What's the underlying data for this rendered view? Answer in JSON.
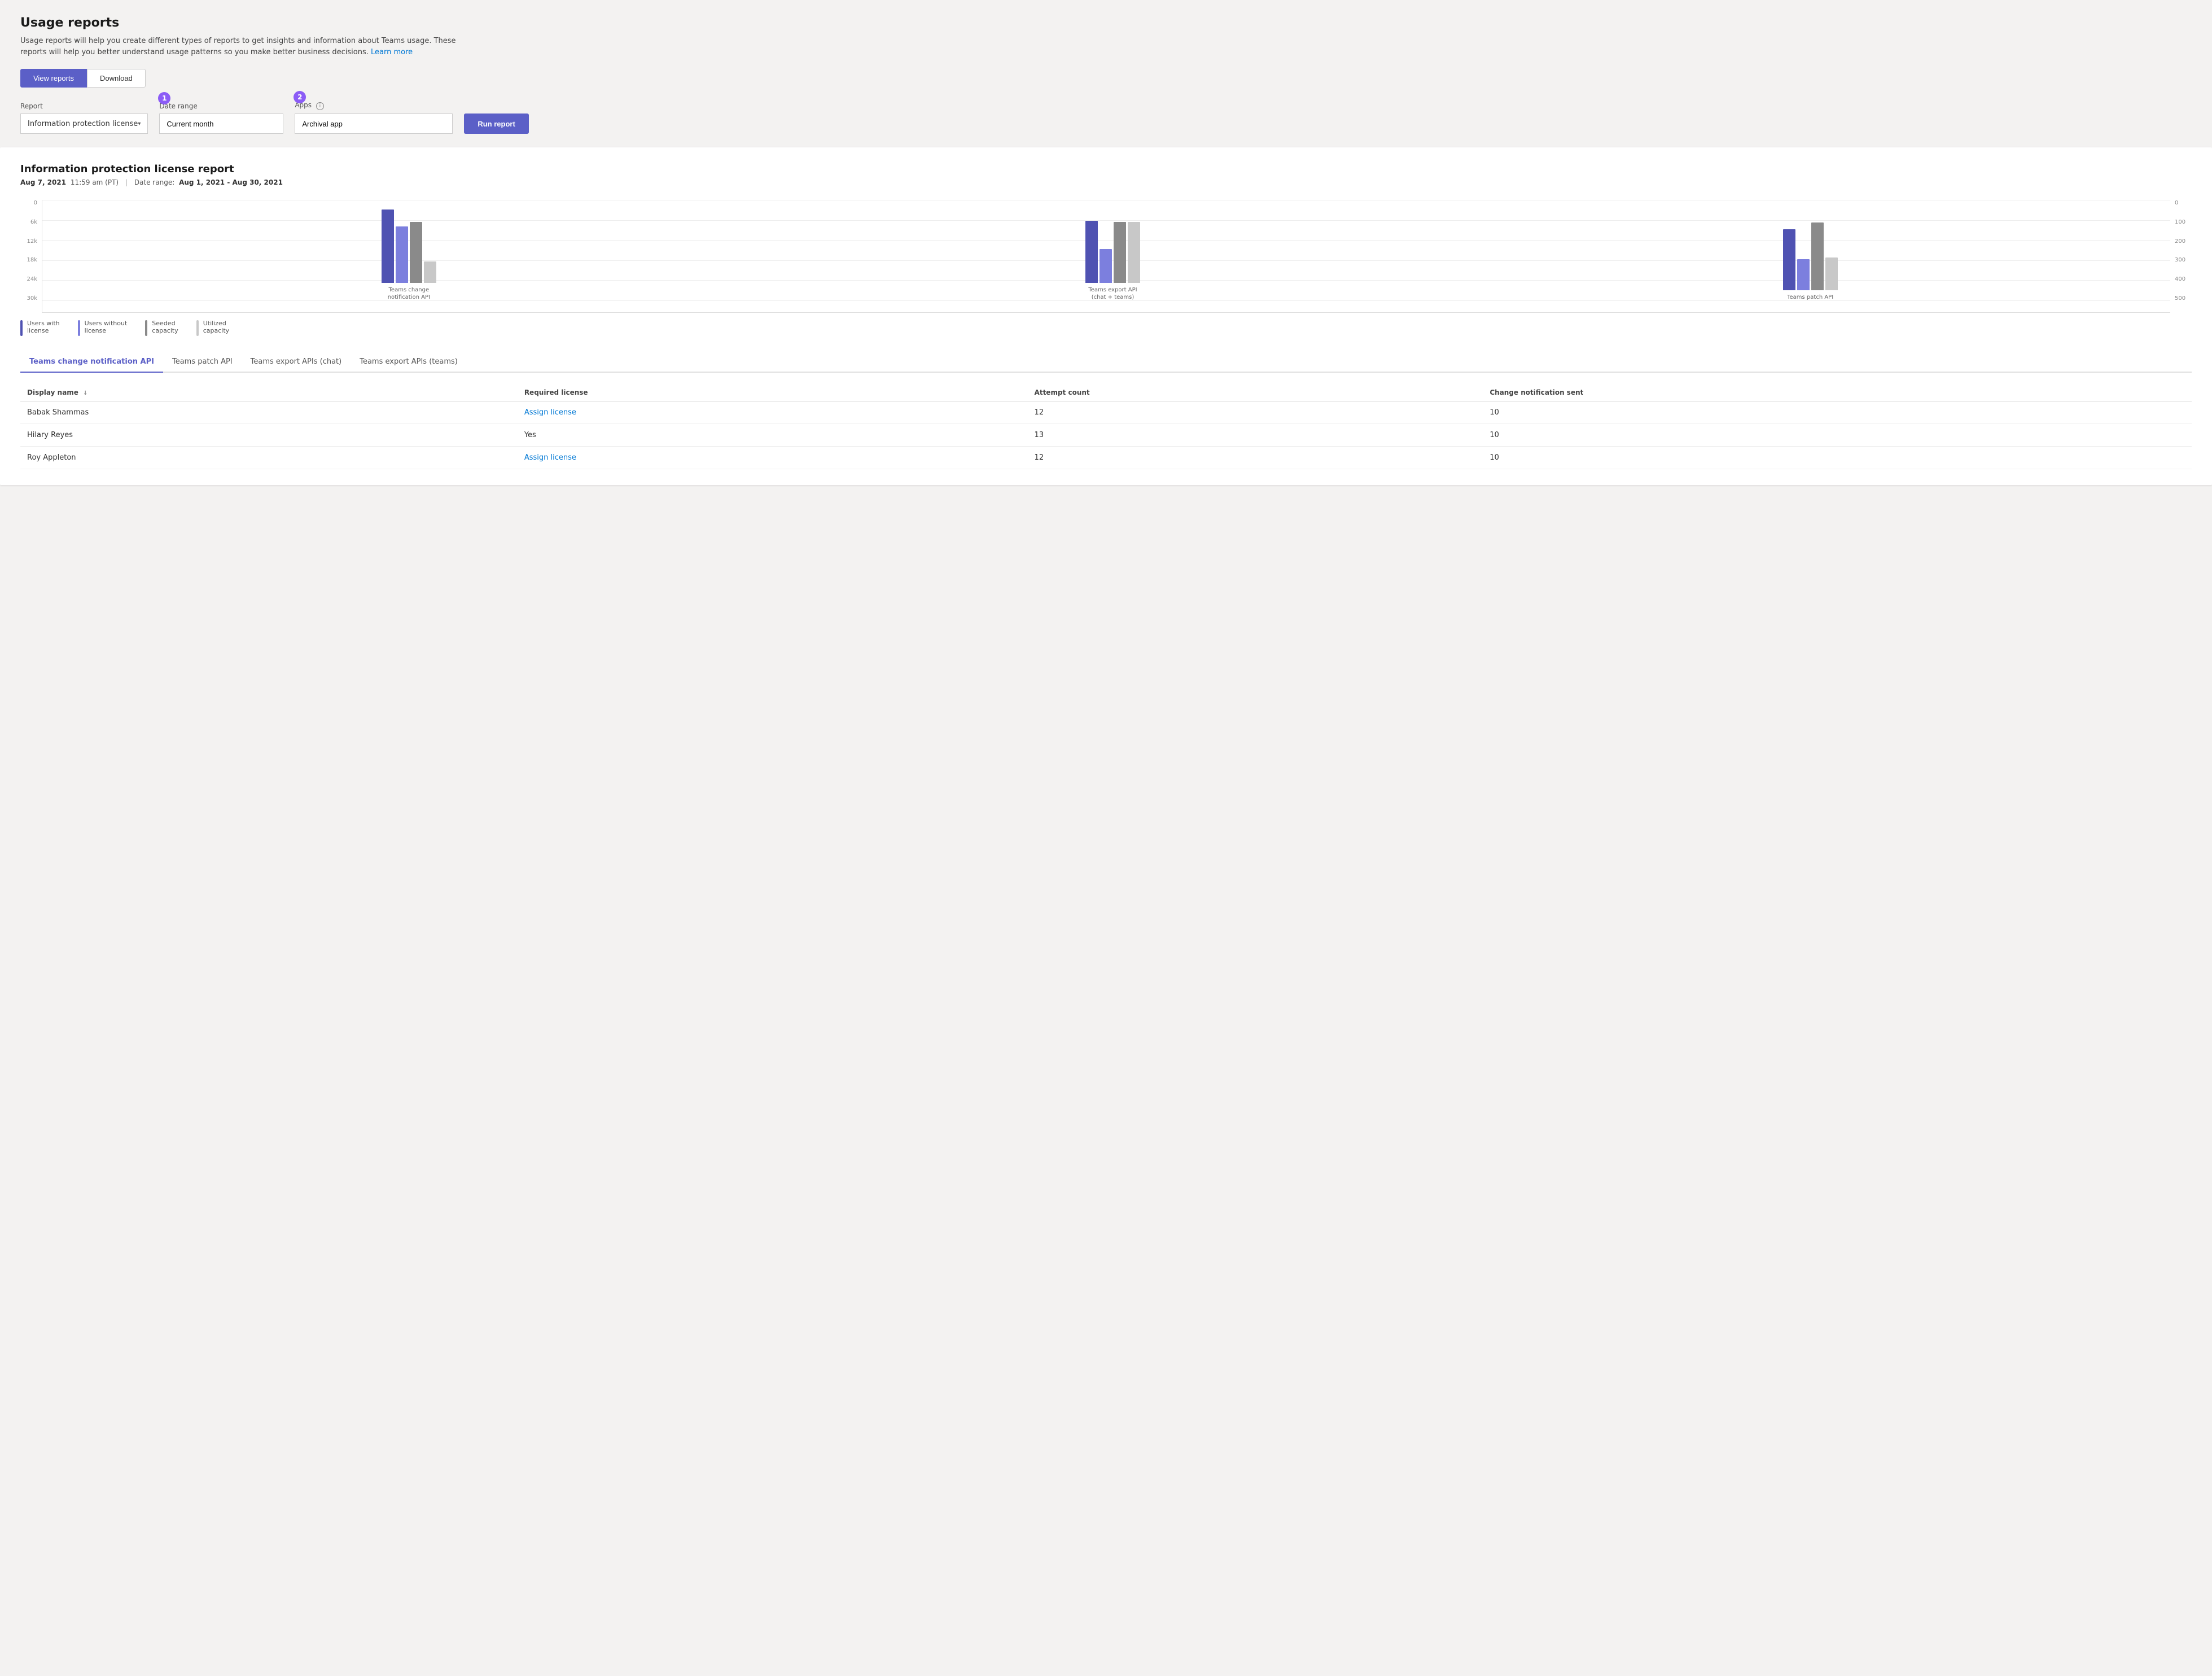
{
  "page": {
    "title": "Usage reports",
    "description": "Usage reports will help you create different types of reports to get insights and information about Teams usage. These reports will help you better understand usage patterns so you make better business decisions.",
    "learn_more_text": "Learn more",
    "tabs": [
      {
        "id": "view-reports",
        "label": "View reports",
        "active": true
      },
      {
        "id": "download",
        "label": "Download",
        "active": false
      }
    ]
  },
  "filters": {
    "report_label": "Report",
    "report_value": "Information protection license",
    "date_range_label": "Date range",
    "date_range_value": "Current month",
    "date_range_step": "1",
    "apps_label": "Apps",
    "apps_step": "2",
    "apps_value": "Archival app",
    "run_button_label": "Run report"
  },
  "report": {
    "title": "Information protection license report",
    "timestamp": "Aug 7, 2021",
    "time": "11:59 am (PT)",
    "date_range_label": "Date range:",
    "date_range_value": "Aug 1, 2021 - Aug 30, 2021",
    "y_axis_left": [
      "0",
      "6k",
      "12k",
      "18k",
      "24k",
      "30k"
    ],
    "y_axis_right": [
      "0",
      "100",
      "200",
      "300",
      "400",
      "500"
    ],
    "chart_groups": [
      {
        "label": "Teams change notification API",
        "bars": [
          {
            "type": "blue",
            "height": 130
          },
          {
            "type": "purple",
            "height": 100
          },
          {
            "type": "gray",
            "height": 108
          },
          {
            "type": "lightgray",
            "height": 38
          }
        ]
      },
      {
        "label": "Teams export API\n(chat + teams)",
        "bars": [
          {
            "type": "blue",
            "height": 110
          },
          {
            "type": "purple",
            "height": 60
          },
          {
            "type": "gray",
            "height": 108
          },
          {
            "type": "lightgray",
            "height": 108
          }
        ]
      },
      {
        "label": "Teams patch API",
        "bars": [
          {
            "type": "blue",
            "height": 108
          },
          {
            "type": "purple",
            "height": 55
          },
          {
            "type": "gray",
            "height": 120
          },
          {
            "type": "lightgray",
            "height": 58
          }
        ]
      }
    ],
    "legend": [
      {
        "color": "#4f52b2",
        "label": "Users with\nlicense"
      },
      {
        "color": "#7c7fde",
        "label": "Users without\nlicense"
      },
      {
        "color": "#8a8a8a",
        "label": "Seeded\ncapacity"
      },
      {
        "color": "#c8c8c8",
        "label": "Utilized\ncapacity"
      }
    ],
    "data_tabs": [
      {
        "id": "change-notification",
        "label": "Teams change notification API",
        "active": true
      },
      {
        "id": "patch-api",
        "label": "Teams patch API",
        "active": false
      },
      {
        "id": "export-chat",
        "label": "Teams export APIs (chat)",
        "active": false
      },
      {
        "id": "export-teams",
        "label": "Teams export APIs (teams)",
        "active": false
      }
    ],
    "table": {
      "columns": [
        {
          "id": "display-name",
          "label": "Display name",
          "sortable": true
        },
        {
          "id": "required-license",
          "label": "Required license",
          "sortable": false
        },
        {
          "id": "attempt-count",
          "label": "Attempt count",
          "sortable": false
        },
        {
          "id": "change-notification-sent",
          "label": "Change notification sent",
          "sortable": false
        }
      ],
      "rows": [
        {
          "display_name": "Babak Shammas",
          "required_license": "Assign license",
          "is_link": true,
          "attempt_count": "12",
          "change_notification_sent": "10"
        },
        {
          "display_name": "Hilary Reyes",
          "required_license": "Yes",
          "is_link": false,
          "attempt_count": "13",
          "change_notification_sent": "10"
        },
        {
          "display_name": "Roy Appleton",
          "required_license": "Assign license",
          "is_link": true,
          "attempt_count": "12",
          "change_notification_sent": "10"
        }
      ]
    }
  }
}
